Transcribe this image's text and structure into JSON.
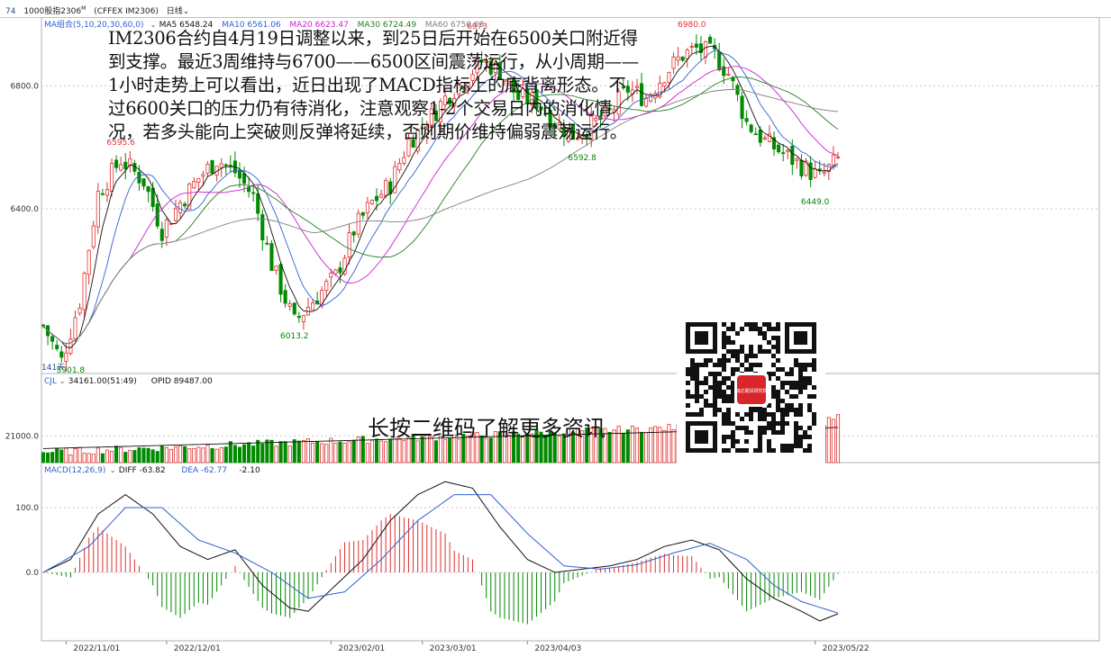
{
  "toolbar": {
    "code": "74",
    "name": "1000股指2306",
    "sup": "M",
    "contract": "(CFFEX IM2306)",
    "period": "日线"
  },
  "colors": {
    "up": "#e03030",
    "down": "#008a00",
    "ma5": "#111111",
    "ma10": "#3060d0",
    "ma20": "#d020d0",
    "ma30": "#208020",
    "ma60": "#808080",
    "diff": "#111111",
    "dea": "#3060d0",
    "grid": "#c8c8c8"
  },
  "overlay": {
    "text": "IM2306合约自4月19日调整以来，到25日后开始在6500关口附近得到支撑。最近3周维持与6700——6500区间震荡运行，从小周期——1小时走势上可以看出，近日出现了MACD指标上的底背离形态。不过6600关口的压力仍有待消化，注意观察1-2个交易日内的消化情况，若多头能向上突破则反弹将延续，否则期价维持偏弱震荡运行。"
  },
  "qr": {
    "badge": "瑞达期货研究院",
    "caption": "长按二维码了解更多资讯"
  },
  "chart_data": [
    {
      "type": "candlestick",
      "panel": "price",
      "legend": [
        {
          "label": "MA组合(5,10,20,30,60,0)",
          "color": "#3060d0"
        },
        {
          "label": "MA5 6548.24",
          "color": "#111111"
        },
        {
          "label": "MA10 6561.06",
          "color": "#3060d0"
        },
        {
          "label": "MA20 6623.47",
          "color": "#d020d0"
        },
        {
          "label": "MA30 6724.49",
          "color": "#208020"
        },
        {
          "label": "MA60 6750.68",
          "color": "#808080"
        }
      ],
      "yticks": [
        6800.0,
        6400.0
      ],
      "ytick_labels": [
        "6800.0",
        "6400.0"
      ],
      "ylim": [
        5870,
        7000
      ],
      "annotations": [
        {
          "label": "6980.0",
          "x": 142,
          "value": 6980.0,
          "color": "#e03030"
        },
        {
          "label": "6595.6",
          "x": 17,
          "value": 6595.6,
          "color": "#e03030"
        },
        {
          "label": "6013.2",
          "x": 55,
          "value": 6013.2,
          "color": "#008a00"
        },
        {
          "label": "6449.0",
          "x": 169,
          "value": 6449.0,
          "color": "#008a00"
        },
        {
          "label": "5901.8",
          "x": 6,
          "value": 5901.8,
          "color": "#008a00"
        },
        {
          "label": "6592.8",
          "x": 118,
          "value": 6592.8,
          "color": "#008a00"
        },
        {
          "label": "6973",
          "x": 95,
          "value": 6973,
          "color": "#e03030"
        }
      ],
      "bottom_left_label": "141天",
      "n_bars": 175,
      "ohlc_keypoints": [
        [
          0,
          6020
        ],
        [
          4,
          5905
        ],
        [
          8,
          6100
        ],
        [
          12,
          6450
        ],
        [
          17,
          6560
        ],
        [
          22,
          6490
        ],
        [
          26,
          6330
        ],
        [
          30,
          6420
        ],
        [
          34,
          6500
        ],
        [
          38,
          6560
        ],
        [
          42,
          6520
        ],
        [
          46,
          6440
        ],
        [
          50,
          6220
        ],
        [
          55,
          6030
        ],
        [
          59,
          6100
        ],
        [
          64,
          6180
        ],
        [
          68,
          6330
        ],
        [
          72,
          6420
        ],
        [
          76,
          6480
        ],
        [
          80,
          6620
        ],
        [
          84,
          6680
        ],
        [
          88,
          6760
        ],
        [
          92,
          6820
        ],
        [
          96,
          6880
        ],
        [
          100,
          6850
        ],
        [
          104,
          6760
        ],
        [
          108,
          6750
        ],
        [
          112,
          6680
        ],
        [
          116,
          6640
        ],
        [
          120,
          6670
        ],
        [
          124,
          6710
        ],
        [
          128,
          6790
        ],
        [
          132,
          6760
        ],
        [
          136,
          6840
        ],
        [
          140,
          6900
        ],
        [
          143,
          6920
        ],
        [
          147,
          6900
        ],
        [
          150,
          6840
        ],
        [
          154,
          6680
        ],
        [
          158,
          6620
        ],
        [
          162,
          6580
        ],
        [
          166,
          6540
        ],
        [
          170,
          6500
        ],
        [
          174,
          6560
        ]
      ]
    },
    {
      "type": "bar",
      "panel": "volume",
      "legend": [
        {
          "label": "CJL",
          "color": "#3060d0"
        },
        {
          "label": "34161.00(51:49)",
          "color": "#111111"
        },
        {
          "label": "OPID 89487.00",
          "color": "#111111"
        }
      ],
      "yticks": [
        21000.0
      ],
      "ytick_labels": [
        "21000.0"
      ],
      "ylim": [
        0,
        60000
      ]
    },
    {
      "type": "bar",
      "panel": "macd",
      "legend": [
        {
          "label": "MACD(12,26,9)",
          "color": "#3060d0"
        },
        {
          "label": "DIFF -63.82",
          "color": "#111111"
        },
        {
          "label": "DEA -62.77",
          "color": "#3060d0"
        },
        {
          "label": "-2.10",
          "color": "#111111"
        }
      ],
      "yticks": [
        100.0,
        0.0
      ],
      "ytick_labels": [
        "100.0",
        "0.0"
      ],
      "ylim": [
        -100,
        150
      ],
      "diff_keypoints": [
        [
          0,
          0
        ],
        [
          6,
          20
        ],
        [
          12,
          90
        ],
        [
          18,
          120
        ],
        [
          24,
          90
        ],
        [
          30,
          40
        ],
        [
          36,
          20
        ],
        [
          42,
          35
        ],
        [
          48,
          -20
        ],
        [
          54,
          -55
        ],
        [
          58,
          -60
        ],
        [
          64,
          -20
        ],
        [
          70,
          20
        ],
        [
          76,
          80
        ],
        [
          82,
          120
        ],
        [
          88,
          140
        ],
        [
          94,
          130
        ],
        [
          100,
          70
        ],
        [
          106,
          20
        ],
        [
          112,
          0
        ],
        [
          118,
          5
        ],
        [
          124,
          10
        ],
        [
          130,
          20
        ],
        [
          136,
          40
        ],
        [
          142,
          50
        ],
        [
          148,
          35
        ],
        [
          154,
          -10
        ],
        [
          160,
          -40
        ],
        [
          166,
          -60
        ],
        [
          170,
          -75
        ],
        [
          174,
          -63.82
        ]
      ],
      "dea_keypoints": [
        [
          0,
          0
        ],
        [
          10,
          40
        ],
        [
          18,
          100
        ],
        [
          26,
          100
        ],
        [
          34,
          50
        ],
        [
          42,
          30
        ],
        [
          50,
          0
        ],
        [
          58,
          -40
        ],
        [
          66,
          -30
        ],
        [
          74,
          20
        ],
        [
          82,
          80
        ],
        [
          90,
          120
        ],
        [
          98,
          120
        ],
        [
          106,
          60
        ],
        [
          114,
          10
        ],
        [
          122,
          5
        ],
        [
          130,
          12
        ],
        [
          138,
          30
        ],
        [
          146,
          45
        ],
        [
          154,
          20
        ],
        [
          160,
          -20
        ],
        [
          166,
          -45
        ],
        [
          174,
          -62.77
        ]
      ]
    }
  ],
  "xaxis": {
    "ticks": [
      {
        "i": 5,
        "label": "2022/11/01"
      },
      {
        "i": 27,
        "label": "2022/12/01"
      },
      {
        "i": 63,
        "label": "2023/02/01"
      },
      {
        "i": 83,
        "label": "2023/03/01"
      },
      {
        "i": 106,
        "label": "2023/04/03"
      },
      {
        "i": 169,
        "label": "2023/05/22"
      }
    ]
  }
}
